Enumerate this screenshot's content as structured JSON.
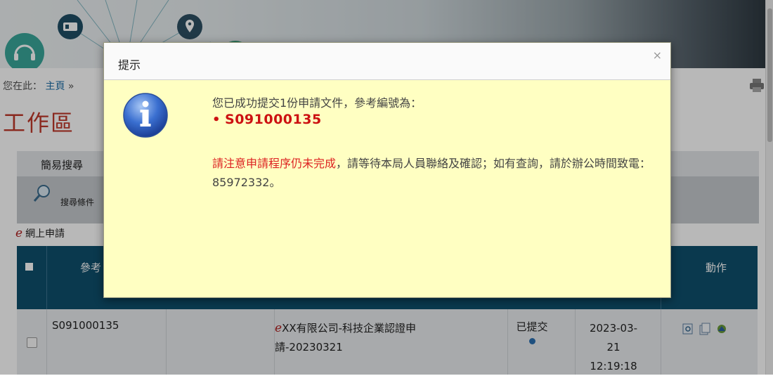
{
  "breadcrumb": {
    "prefix": "您在此：",
    "home": "主頁",
    "sep": "»"
  },
  "page": {
    "title": "工作區"
  },
  "search": {
    "header": "簡易搜尋",
    "criteria_label": "搜尋條件"
  },
  "section": {
    "label": "網上申請",
    "e_glyph": "e"
  },
  "table": {
    "headers": {
      "ref": "參考",
      "action": "動作"
    },
    "rows": [
      {
        "ref": "S091000135",
        "title_line1": "XX有限公司-科技企業認證申",
        "title_line2": "請-20230321",
        "status": "已提交",
        "date": "2023-03-",
        "day": "21",
        "time": "12:19:18"
      }
    ]
  },
  "modal": {
    "title": "提示",
    "close_glyph": "×",
    "line1": "您已成功提交1份申請文件，參考編號為：",
    "bullet": "•",
    "reference": "S091000135",
    "warn": "請注意申請程序仍未完成",
    "line2_rest": "，請等待本局人員聯絡及確認；如有查詢，請於辦公時間致電：85972332。"
  },
  "colors": {
    "title_red": "#c0392b",
    "table_header": "#0f4f6c",
    "modal_bg": "#ffffc2",
    "reference_red": "#cc1111"
  },
  "icons": [
    "headset-icon",
    "id-card-icon",
    "location-pin-icon",
    "print-icon",
    "magnifier-icon",
    "info-icon",
    "view-icon",
    "copy-icon",
    "share-icon"
  ]
}
